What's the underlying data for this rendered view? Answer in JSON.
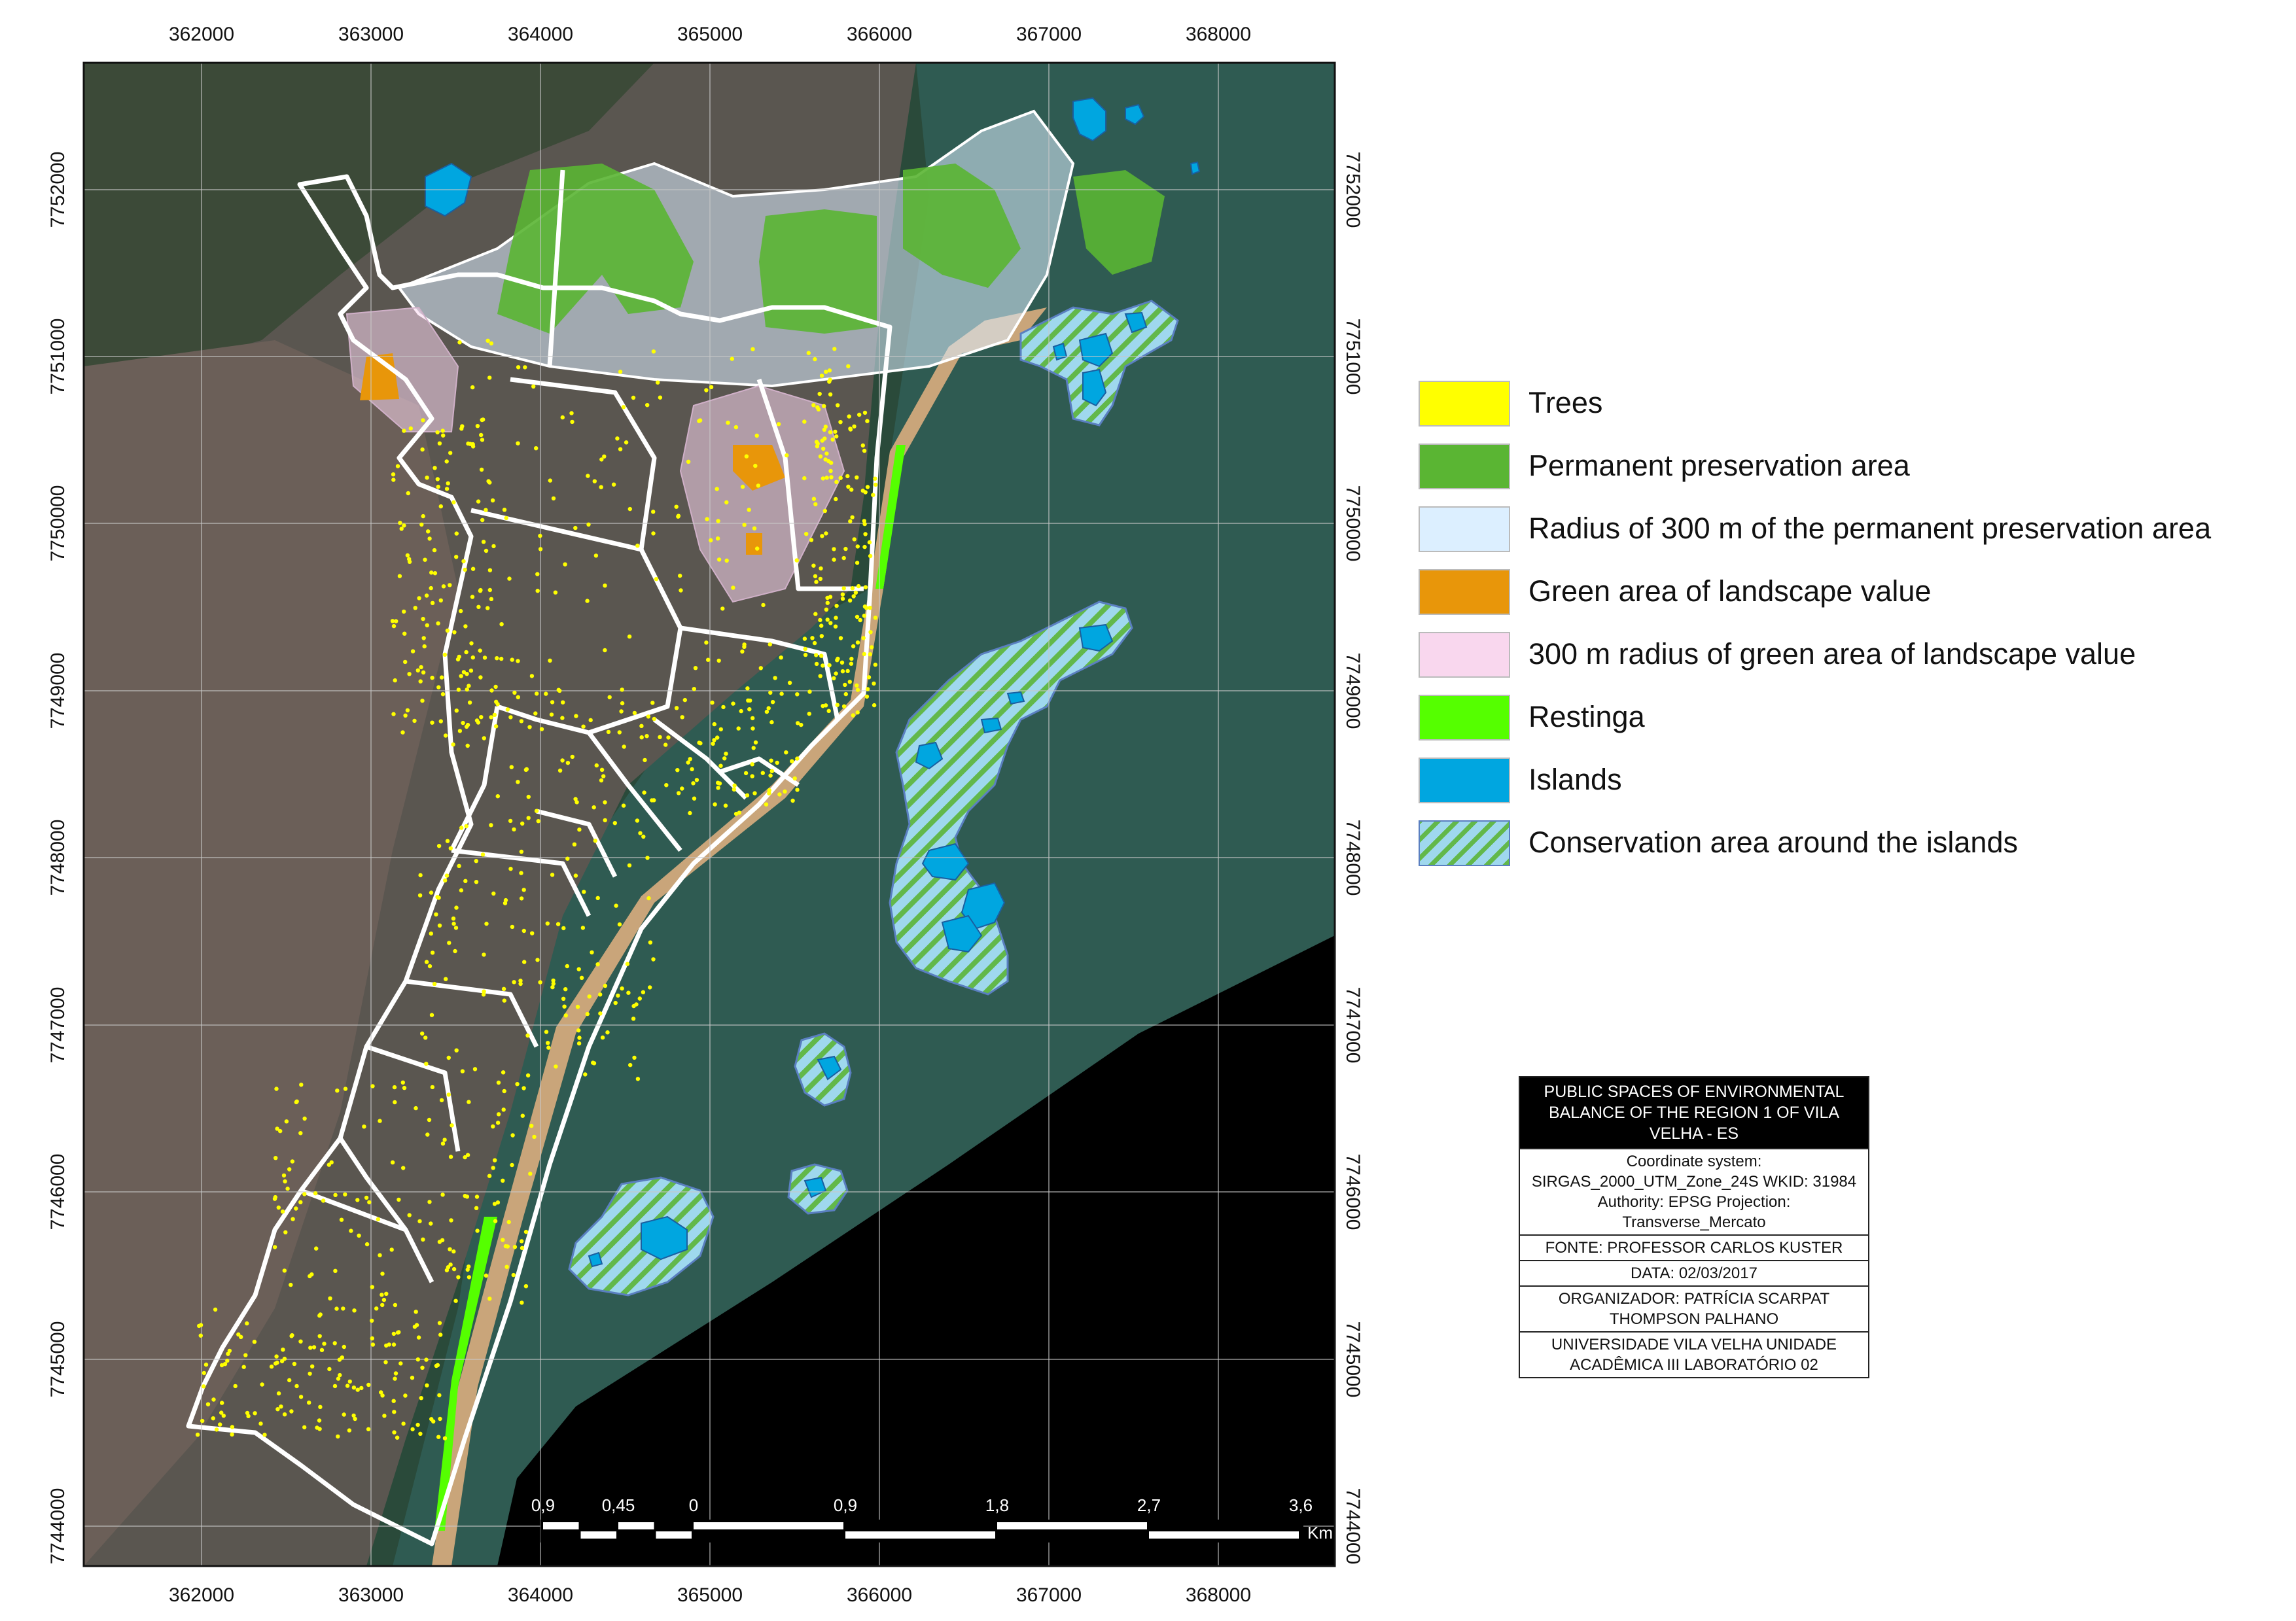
{
  "map": {
    "x_ticks": [
      "362000",
      "363000",
      "364000",
      "365000",
      "366000",
      "367000",
      "368000"
    ],
    "y_ticks": [
      "7752000",
      "7751000",
      "7750000",
      "7749000",
      "7748000",
      "7747000",
      "7746000",
      "7745000",
      "7744000"
    ],
    "scale": {
      "labels": [
        "0,9",
        "0,45",
        "0",
        "0,9",
        "1,8",
        "2,7",
        "3,6"
      ],
      "unit": "Km"
    }
  },
  "legend": [
    {
      "label": "Trees",
      "color": "#ffff00",
      "pattern": "solid"
    },
    {
      "label": "Permanent preservation area",
      "color": "#5ab533",
      "pattern": "solid"
    },
    {
      "label": "Radius of 300 m of the permanent preservation area",
      "color": "#dcefff",
      "pattern": "solid"
    },
    {
      "label": "Green area of landscape value",
      "color": "#e8960a",
      "pattern": "solid"
    },
    {
      "label": "300 m radius of green area of landscape value",
      "color": "#f9d7ee",
      "pattern": "solid"
    },
    {
      "label": "Restinga",
      "color": "#55ff00",
      "pattern": "solid"
    },
    {
      "label": "Islands",
      "color": "#00a6e0",
      "pattern": "solid"
    },
    {
      "label": "Conservation area around the islands",
      "color": "#9fd8ee",
      "pattern": "hatch"
    }
  ],
  "info_box": {
    "title": "PUBLIC SPACES OF ENVIRONMENTAL BALANCE OF THE REGION 1 OF VILA VELHA - ES",
    "coordinate": "Coordinate system: SIRGAS_2000_UTM_Zone_24S WKID: 31984 Authority: EPSG Projection: Transverse_Mercato",
    "fonte": "FONTE: PROFESSOR CARLOS KUSTER",
    "data": "DATA: 02/03/2017",
    "organizador": "ORGANIZADOR: PATRÍCIA SCARPAT THOMPSON PALHANO",
    "universidade": "UNIVERSIDADE VILA VELHA UNIDADE ACADÊMICA III LABORATÓRIO 02"
  }
}
